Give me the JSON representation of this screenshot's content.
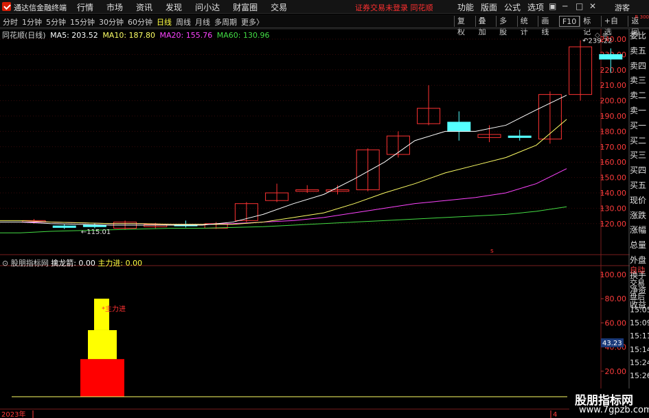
{
  "app": {
    "title": "通达信金融终端",
    "warning": "证券交易未登录  同花顺",
    "guest": "游客"
  },
  "menu": [
    "行情",
    "市场",
    "资讯",
    "发现",
    "问小达",
    "财富圈",
    "交易"
  ],
  "right_menu": [
    "功能",
    "版面",
    "公式",
    "选项"
  ],
  "periods": [
    {
      "label": "分时",
      "active": false
    },
    {
      "label": "1分钟",
      "active": false
    },
    {
      "label": "5分钟",
      "active": false
    },
    {
      "label": "15分钟",
      "active": false
    },
    {
      "label": "30分钟",
      "active": false
    },
    {
      "label": "60分钟",
      "active": false
    },
    {
      "label": "日线",
      "active": true
    },
    {
      "label": "周线",
      "active": false
    },
    {
      "label": "月线",
      "active": false
    },
    {
      "label": "多周期",
      "active": false
    },
    {
      "label": "更多〉",
      "active": false
    }
  ],
  "tools": [
    "复权",
    "叠加",
    "多股",
    "统计",
    "画线",
    "F10",
    "标记",
    "+自选",
    "返回"
  ],
  "chart": {
    "stock": "同花顺(日线)",
    "ma": [
      {
        "label": "MA5: 203.52",
        "color": "#ffffff"
      },
      {
        "label": "MA10: 187.80",
        "color": "#ffff66"
      },
      {
        "label": "MA20: 155.76",
        "color": "#ff44ff"
      },
      {
        "label": "MA60: 130.96",
        "color": "#44dd44"
      }
    ],
    "high_label": "239.22",
    "low_label": "115.01",
    "price_ticks": [
      "240.00",
      "230.00",
      "220.00",
      "210.00",
      "200.00",
      "190.00",
      "180.00",
      "170.00",
      "160.00",
      "150.00",
      "140.00",
      "130.00",
      "120.00"
    ],
    "candles": [
      {
        "o": 121,
        "c": 122,
        "h": 123,
        "l": 120
      },
      {
        "o": 118.5,
        "c": 117.5,
        "h": 119.5,
        "l": 116.5
      },
      {
        "o": 119,
        "c": 118,
        "h": 120,
        "l": 117
      },
      {
        "o": 117,
        "c": 121,
        "h": 122,
        "l": 116
      },
      {
        "o": 118,
        "c": 119.5,
        "h": 120.5,
        "l": 117
      },
      {
        "o": 119.5,
        "c": 118.5,
        "h": 122,
        "l": 117.5
      },
      {
        "o": 117,
        "c": 120,
        "h": 121,
        "l": 116.5
      },
      {
        "o": 122,
        "c": 133,
        "h": 134,
        "l": 121
      },
      {
        "o": 135,
        "c": 140,
        "h": 146,
        "l": 134
      },
      {
        "o": 141,
        "c": 142,
        "h": 145,
        "l": 140
      },
      {
        "o": 141,
        "c": 142,
        "h": 145,
        "l": 139
      },
      {
        "o": 142,
        "c": 168,
        "h": 169,
        "l": 141
      },
      {
        "o": 165,
        "c": 177,
        "h": 180,
        "l": 163
      },
      {
        "o": 185,
        "c": 195,
        "h": 210,
        "l": 184
      },
      {
        "o": 186,
        "c": 180,
        "h": 193,
        "l": 174
      },
      {
        "o": 176,
        "c": 178,
        "h": 184,
        "l": 173
      },
      {
        "o": 177,
        "c": 176,
        "h": 181,
        "l": 174
      },
      {
        "o": 175,
        "c": 204,
        "h": 206,
        "l": 172
      },
      {
        "o": 204,
        "c": 235,
        "h": 239.22,
        "l": 200
      },
      {
        "o": 230,
        "c": 227,
        "h": 234,
        "l": 218
      }
    ],
    "ma5": [
      121,
      120,
      119.5,
      119,
      119,
      119,
      119,
      121,
      126,
      133,
      139,
      149,
      160,
      174,
      180,
      180,
      184,
      194,
      203.52
    ],
    "ma10": [
      122,
      121,
      120.5,
      120,
      120,
      119.5,
      119.5,
      119.5,
      121,
      124,
      127,
      133,
      140,
      146,
      153,
      158,
      163,
      171,
      187.8
    ],
    "ma20": [
      121,
      121,
      120.5,
      120,
      120,
      119.5,
      119.5,
      120,
      121,
      122,
      124,
      127,
      130,
      133,
      135,
      137,
      140,
      146,
      155.76
    ],
    "ma60": [
      114,
      115,
      115.5,
      116,
      116.5,
      117,
      117,
      117.5,
      118,
      119,
      120,
      121,
      122,
      123,
      124,
      125,
      126,
      128,
      130.96
    ]
  },
  "sub": {
    "name": "股朋指标网",
    "params": [
      {
        "label": "擒龙箭: 0.00",
        "color": "#ffffff"
      },
      {
        "label": "主力进: 0.00",
        "color": "#ffff40"
      }
    ],
    "annotation": "主力进",
    "ticks": [
      "100.00",
      "80.00",
      "60.00",
      "40.00",
      "20.00"
    ],
    "current": "43.23",
    "red_bar": 30,
    "yellow_bar": 80
  },
  "right_panel": [
    "委比",
    "卖五",
    "卖四",
    "卖三",
    "卖二",
    "卖一",
    "买一",
    "买二",
    "买三",
    "买四",
    "买五",
    "现价",
    "涨跌",
    "涨幅",
    "总量",
    "外盘",
    "换手",
    "净资",
    "收益"
  ],
  "right_panel2": [
    "自动",
    "交易",
    "盘后",
    "15:05",
    "15:09",
    "15:11",
    "15:14",
    "15:24",
    "15:26"
  ],
  "right_top": "R 300",
  "footer": {
    "year": "2023年",
    "marker": "4"
  },
  "watermark": {
    "line1": "股朋指标网",
    "line2": "www.7gpzb.com"
  },
  "colors": {
    "up": "#ff3232",
    "down": "#54ffff",
    "ma5": "#ffffff",
    "ma10": "#ffff66",
    "ma20": "#ff44ff",
    "ma60": "#44dd44"
  }
}
